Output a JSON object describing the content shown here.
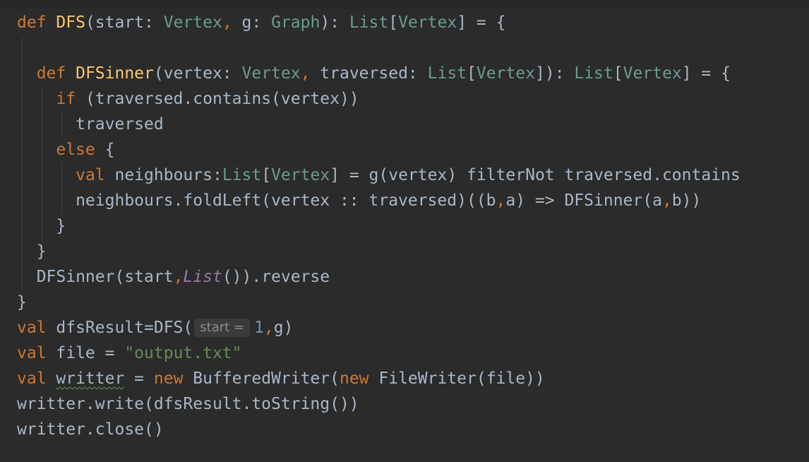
{
  "editor": {
    "language": "scala",
    "lines": [
      [
        [
          "kw",
          "def "
        ],
        [
          "fn",
          "DFS"
        ],
        [
          "plain",
          "(start: "
        ],
        [
          "type",
          "Vertex"
        ],
        [
          "kw",
          ", "
        ],
        [
          "plain",
          "g: "
        ],
        [
          "type",
          "Graph"
        ],
        [
          "plain",
          "): "
        ],
        [
          "type",
          "List"
        ],
        [
          "plain",
          "["
        ],
        [
          "type",
          "Vertex"
        ],
        [
          "plain",
          "] = {"
        ]
      ],
      [],
      [
        [
          "plain",
          "  "
        ],
        [
          "kw",
          "def "
        ],
        [
          "fn",
          "DFSinner"
        ],
        [
          "plain",
          "(vertex: "
        ],
        [
          "type",
          "Vertex"
        ],
        [
          "kw",
          ", "
        ],
        [
          "plain",
          "traversed: "
        ],
        [
          "type",
          "List"
        ],
        [
          "plain",
          "["
        ],
        [
          "type",
          "Vertex"
        ],
        [
          "plain",
          "]): "
        ],
        [
          "type",
          "List"
        ],
        [
          "plain",
          "["
        ],
        [
          "type",
          "Vertex"
        ],
        [
          "plain",
          "] = {"
        ]
      ],
      [
        [
          "plain",
          "    "
        ],
        [
          "kw",
          "if "
        ],
        [
          "plain",
          "(traversed.contains(vertex))"
        ]
      ],
      [
        [
          "plain",
          "      traversed"
        ]
      ],
      [
        [
          "plain",
          "    "
        ],
        [
          "kw",
          "else "
        ],
        [
          "plain",
          "{"
        ]
      ],
      [
        [
          "plain",
          "      "
        ],
        [
          "kw",
          "val "
        ],
        [
          "plain",
          "neighbours:"
        ],
        [
          "type",
          "List"
        ],
        [
          "plain",
          "["
        ],
        [
          "type",
          "Vertex"
        ],
        [
          "plain",
          "] = g(vertex) filterNot traversed.contains"
        ]
      ],
      [
        [
          "plain",
          "      neighbours.foldLeft(vertex :: traversed)((b"
        ],
        [
          "kw",
          ","
        ],
        [
          "plain",
          "a) => DFSinner(a"
        ],
        [
          "kw",
          ","
        ],
        [
          "plain",
          "b))"
        ]
      ],
      [
        [
          "plain",
          "    }"
        ]
      ],
      [
        [
          "plain",
          "  }"
        ]
      ],
      [
        [
          "plain",
          "  DFSinner(start"
        ],
        [
          "kw",
          ","
        ],
        [
          "italic",
          "List"
        ],
        [
          "plain",
          "()).reverse"
        ]
      ],
      [
        [
          "plain",
          "}"
        ]
      ],
      [
        [
          "kw",
          "val "
        ],
        [
          "plain",
          "dfsResult=DFS("
        ],
        [
          "hint",
          "start ="
        ],
        [
          "num",
          "1"
        ],
        [
          "kw",
          ","
        ],
        [
          "plain",
          "g)"
        ]
      ],
      [
        [
          "kw",
          "val "
        ],
        [
          "plain",
          "file = "
        ],
        [
          "str",
          "\"output.txt\""
        ]
      ],
      [
        [
          "kw",
          "val "
        ],
        [
          "squiggle",
          "writter"
        ],
        [
          "plain",
          " = "
        ],
        [
          "kw",
          "new "
        ],
        [
          "plain",
          "BufferedWriter("
        ],
        [
          "kw",
          "new "
        ],
        [
          "plain",
          "FileWriter(file))"
        ]
      ],
      [
        [
          "plain",
          "writter.write(dfsResult.toString())"
        ]
      ],
      [
        [
          "plain",
          "writter.close()"
        ]
      ]
    ]
  }
}
